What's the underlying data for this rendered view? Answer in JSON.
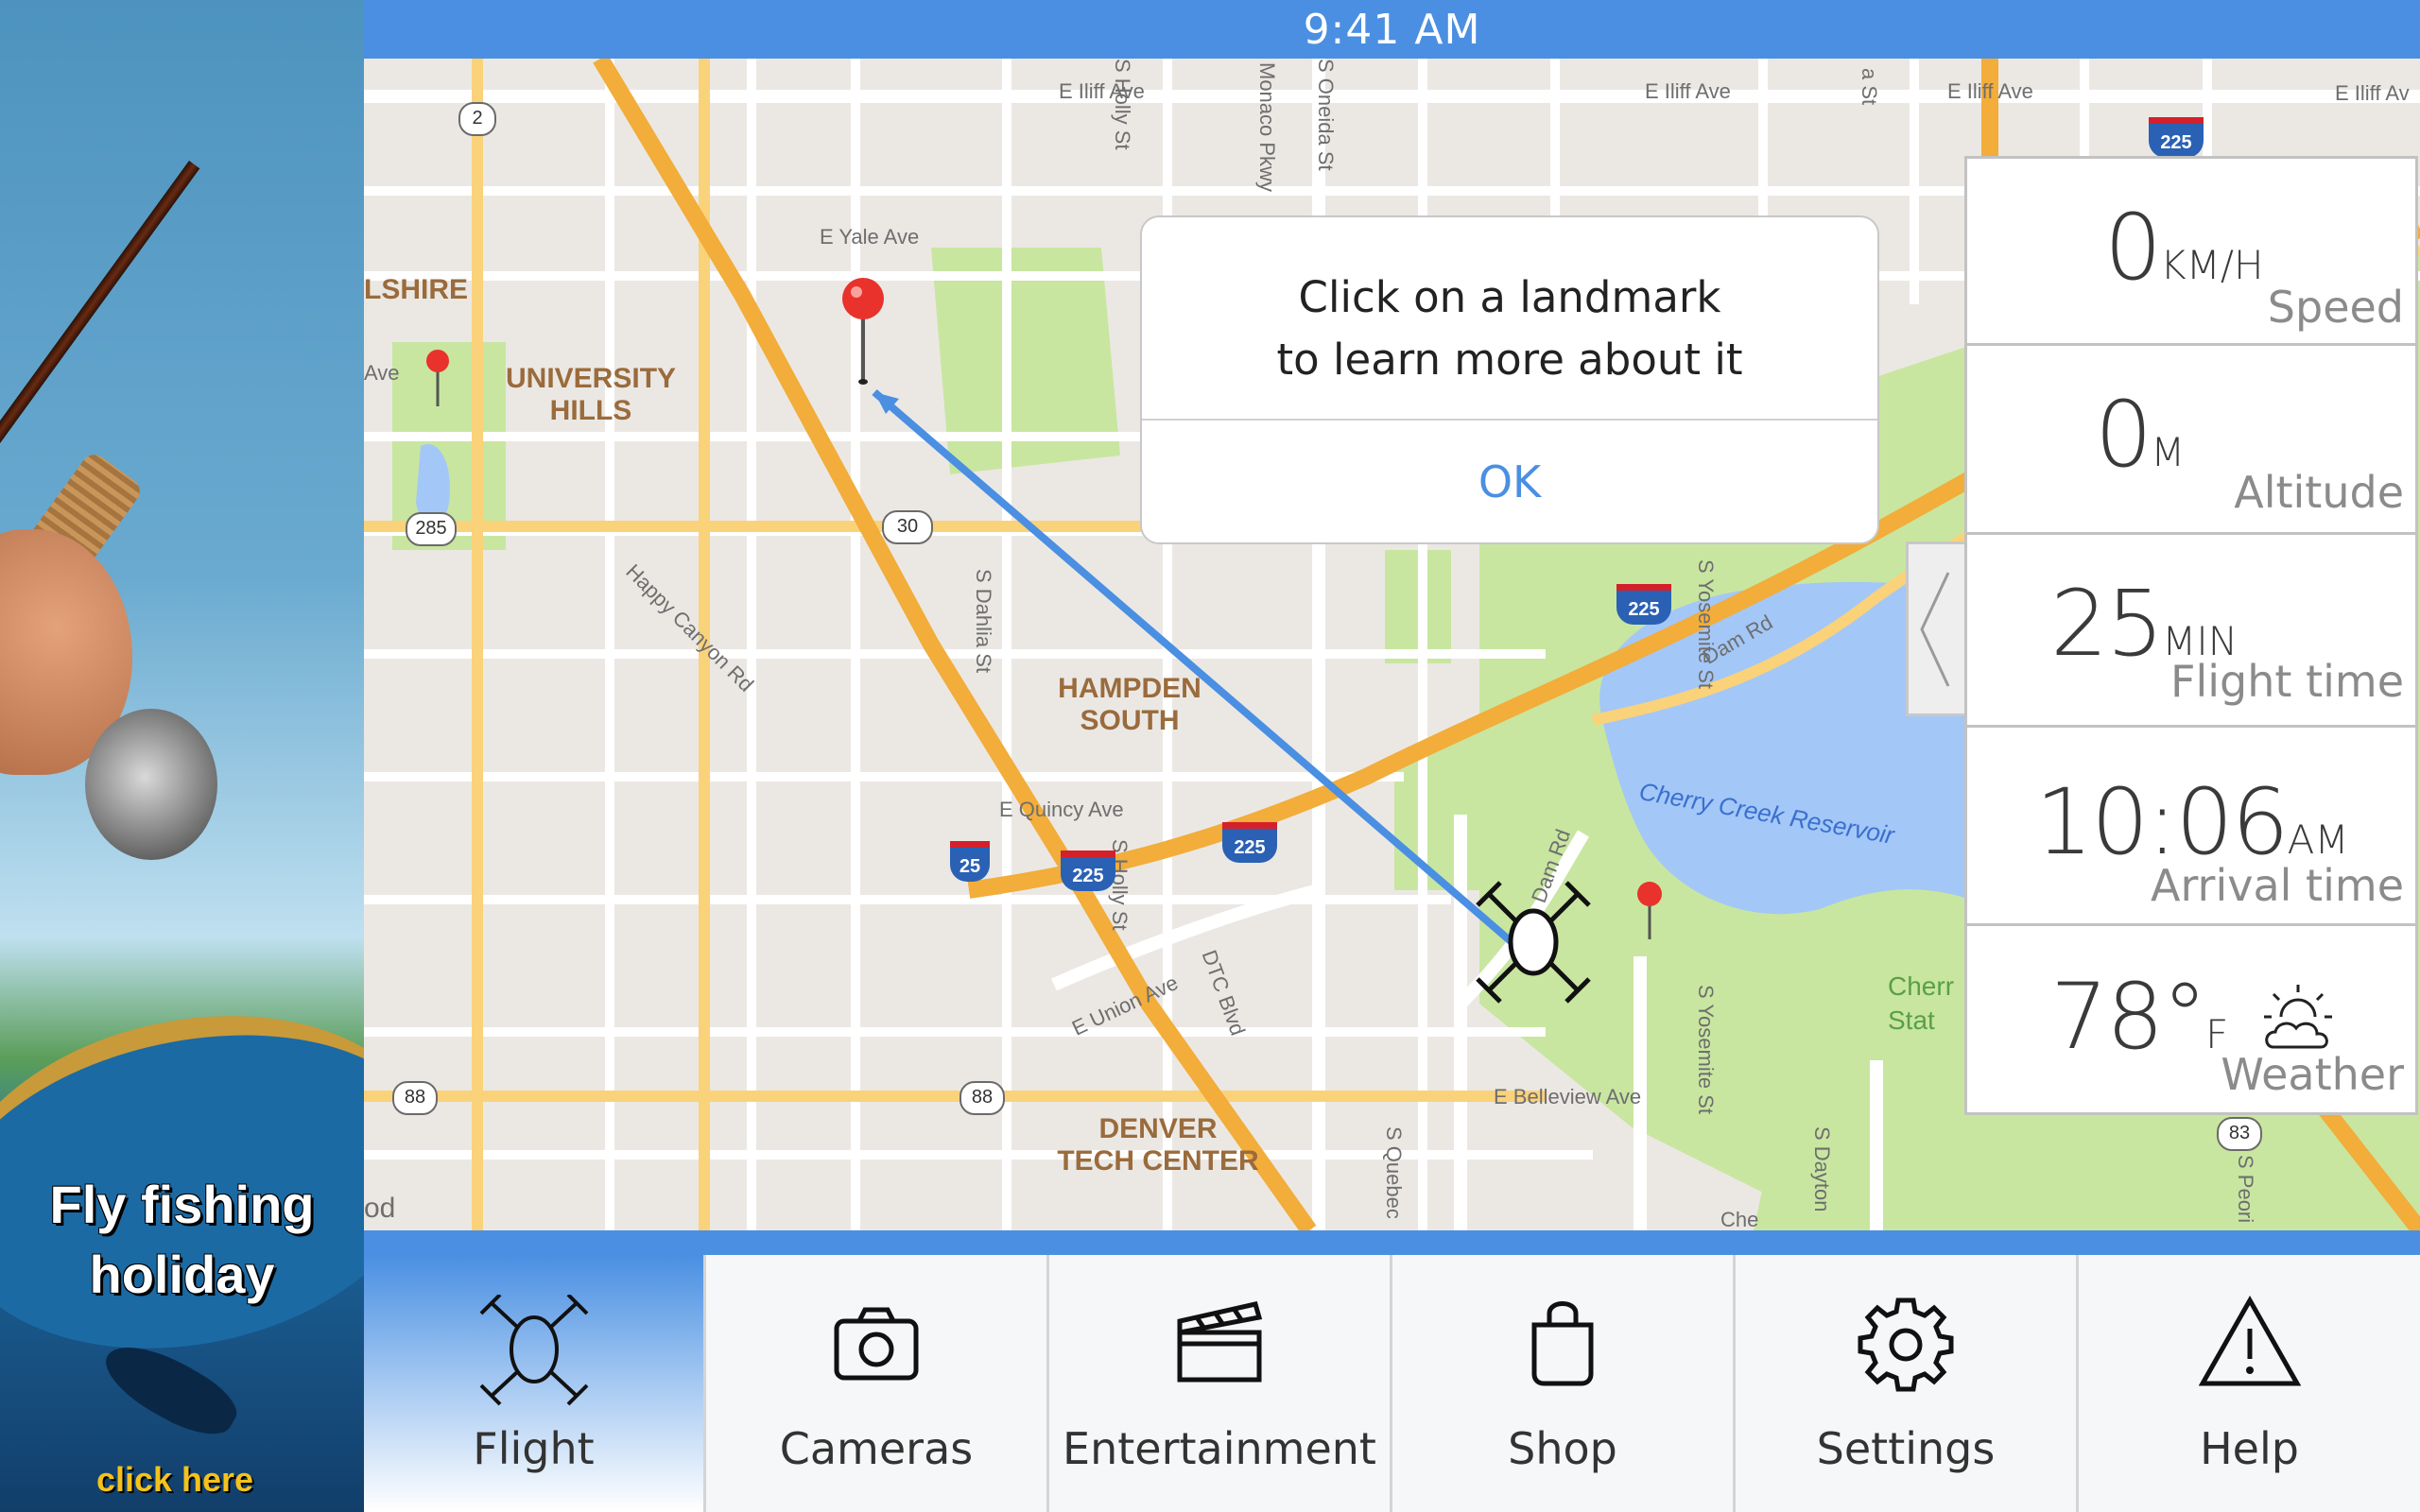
{
  "status_bar": {
    "time": "9:41 AM"
  },
  "ad": {
    "title_line1": "Fly fishing",
    "title_line2": "holiday",
    "cta": "click here"
  },
  "map": {
    "streets": {
      "iliff_1": "E Iliff Ave",
      "iliff_2": "E Iliff Ave",
      "iliff_3": "E Iliff Ave",
      "iliff_4": "E Iliff Av",
      "holly_n": "S Holly St",
      "monaco": "Monaco Pkwy",
      "oneida": "S Oneida St",
      "yale": "E Yale Ave",
      "dahlia": "S Dahlia St",
      "happy_canyon": "Happy Canyon Rd",
      "yosemite_n": "S Yosemite St",
      "quincy": "E Quincy Ave",
      "holly_s": "S Holly St",
      "dam_rd": "Dam Rd",
      "dam_rd_2": "Dam Rd",
      "union": "E Union Ave",
      "dtc": "DTC Blvd",
      "yosemite_s": "S Yosemite St",
      "quebec": "S Quebec",
      "belleview": "E Belleview Ave",
      "dayton": "S Dayton",
      "peoria": "S Peori",
      "ave_w": "Ave",
      "sa_st": "a St",
      "che": "Che",
      "od": "od",
      "cherry_park": "Cherr",
      "stat": "Stat"
    },
    "areas": {
      "shire": "LSHIRE",
      "univ_hills": "UNIVERSITY\nHILLS",
      "hampden": "HAMPDEN\nSOUTH",
      "dtc": "DENVER\nTECH CENTER"
    },
    "water": {
      "reservoir": "Cherry Creek Reservoir"
    },
    "routes": {
      "r2": "2",
      "r285": "285",
      "r30": "30",
      "r88a": "88",
      "r88b": "88",
      "r83": "83",
      "i225a": "225",
      "i225b": "225",
      "i225c": "225",
      "i225d": "225",
      "i25": "25"
    }
  },
  "dialog": {
    "line1": "Click on a landmark",
    "line2": "to learn more about it",
    "ok_label": "OK"
  },
  "info_panel": {
    "speed": {
      "value": "0",
      "unit": "KM/H",
      "label": "Speed"
    },
    "altitude": {
      "value": "0",
      "unit": "M",
      "label": "Altitude"
    },
    "flight_time": {
      "value": "25",
      "unit": "MIN",
      "label": "Flight time"
    },
    "arrival": {
      "value": "10:06",
      "unit": "AM",
      "label": "Arrival time"
    },
    "weather": {
      "value": "78°",
      "unit": "F",
      "label": "Weather",
      "icon": "partly-cloudy-icon"
    }
  },
  "nav": {
    "items": [
      {
        "label": "Flight",
        "icon": "drone-icon"
      },
      {
        "label": "Cameras",
        "icon": "camera-icon"
      },
      {
        "label": "Entertainment",
        "icon": "clapperboard-icon"
      },
      {
        "label": "Shop",
        "icon": "shopping-bag-icon"
      },
      {
        "label": "Settings",
        "icon": "gear-icon"
      },
      {
        "label": "Help",
        "icon": "warning-icon"
      }
    ]
  },
  "colors": {
    "accent": "#4a8fe2",
    "route_line": "#4a8fe2",
    "pin": "#e8322b",
    "park": "#c8e6a0",
    "water": "#a3c7f7"
  }
}
